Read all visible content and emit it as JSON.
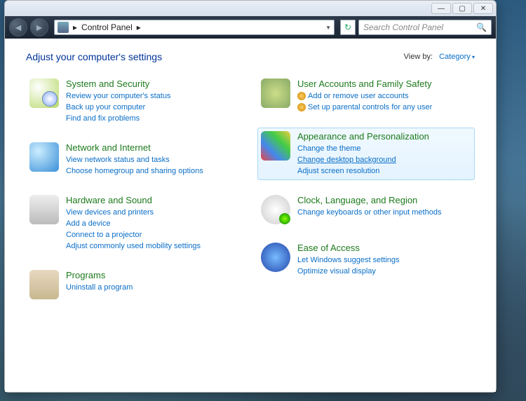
{
  "titlebar": {},
  "navbar": {
    "breadcrumb": "Control Panel",
    "breadcrumb_sep": "▸",
    "search_placeholder": "Search Control Panel"
  },
  "content": {
    "heading": "Adjust your computer's settings",
    "viewby_label": "View by:",
    "viewby_value": "Category",
    "left": [
      {
        "key": "system-security",
        "title": "System and Security",
        "links": [
          "Review your computer's status",
          "Back up your computer",
          "Find and fix problems"
        ]
      },
      {
        "key": "network-internet",
        "title": "Network and Internet",
        "links": [
          "View network status and tasks",
          "Choose homegroup and sharing options"
        ]
      },
      {
        "key": "hardware-sound",
        "title": "Hardware and Sound",
        "links": [
          "View devices and printers",
          "Add a device",
          "Connect to a projector",
          "Adjust commonly used mobility settings"
        ]
      },
      {
        "key": "programs",
        "title": "Programs",
        "links": [
          "Uninstall a program"
        ]
      }
    ],
    "right": [
      {
        "key": "user-accounts",
        "title": "User Accounts and Family Safety",
        "icon_links": [
          "Add or remove user accounts",
          "Set up parental controls for any user"
        ]
      },
      {
        "key": "appearance",
        "title": "Appearance and Personalization",
        "highlight": true,
        "links": [
          "Change the theme",
          "Change desktop background",
          "Adjust screen resolution"
        ],
        "underline_index": 1
      },
      {
        "key": "clock-region",
        "title": "Clock, Language, and Region",
        "links": [
          "Change keyboards or other input methods"
        ]
      },
      {
        "key": "ease-of-access",
        "title": "Ease of Access",
        "links": [
          "Let Windows suggest settings",
          "Optimize visual display"
        ]
      }
    ]
  }
}
